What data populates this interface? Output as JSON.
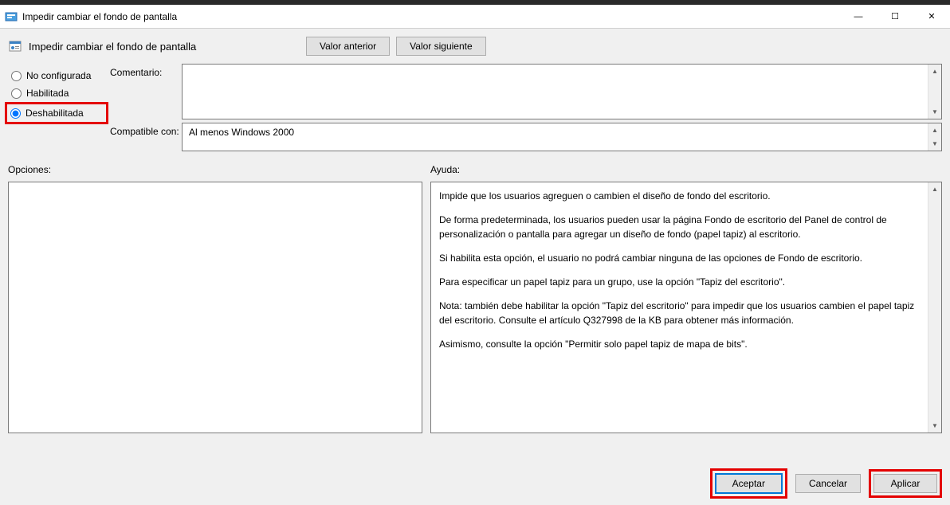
{
  "window": {
    "title": "Impedir cambiar el fondo de pantalla",
    "min": "—",
    "max": "☐",
    "close": "✕"
  },
  "header": {
    "title": "Impedir cambiar el fondo de pantalla",
    "prev_button": "Valor anterior",
    "next_button": "Valor siguiente"
  },
  "radios": {
    "not_configured": "No configurada",
    "enabled": "Habilitada",
    "disabled": "Deshabilitada",
    "selected": "disabled"
  },
  "labels": {
    "comment": "Comentario:",
    "compatible": "Compatible con:",
    "options": "Opciones:",
    "help": "Ayuda:"
  },
  "compat_text": "Al menos Windows 2000",
  "help_text": {
    "p1": "Impide que los usuarios agreguen o cambien el diseño de fondo del escritorio.",
    "p2": "De forma predeterminada, los usuarios pueden usar la página Fondo de escritorio del Panel de control de personalización o pantalla para agregar un diseño de fondo (papel tapiz) al escritorio.",
    "p3": "Si habilita esta opción, el usuario no podrá cambiar ninguna de las opciones de Fondo de escritorio.",
    "p4": "Para especificar un papel tapiz para un grupo, use la opción \"Tapiz del escritorio\".",
    "p5": "Nota: también debe habilitar la opción \"Tapiz del escritorio\" para impedir que los usuarios cambien el papel tapiz del escritorio. Consulte el artículo Q327998 de la KB para obtener más información.",
    "p6": "Asimismo, consulte la opción \"Permitir solo papel tapiz de mapa de bits\"."
  },
  "footer": {
    "ok": "Aceptar",
    "cancel": "Cancelar",
    "apply": "Aplicar"
  }
}
